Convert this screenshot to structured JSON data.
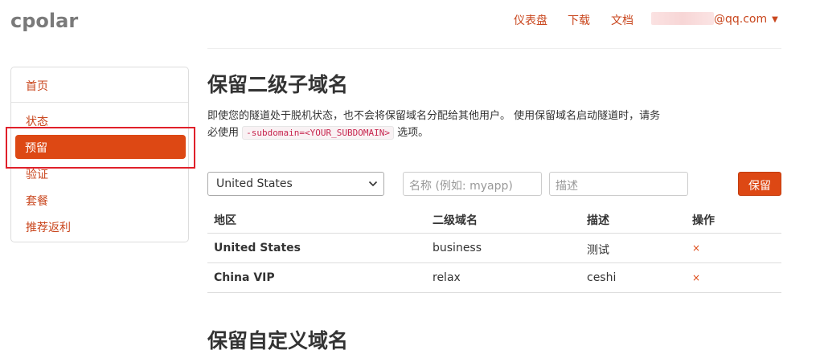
{
  "brand": {
    "logo": "cpolar"
  },
  "topnav": {
    "items": [
      "仪表盘",
      "下载",
      "文档"
    ],
    "user_email_suffix": "@qq.com"
  },
  "sidebar": {
    "items": [
      "首页",
      "状态",
      "预留",
      "验证",
      "套餐",
      "推荐返利"
    ],
    "active_index": 2
  },
  "main": {
    "title": "保留二级子域名",
    "description_part1": "即使您的隧道处于脱机状态，也不会将保留域名分配给其他用户。 使用保留域名启动隧道时，请务必使用",
    "code": "-subdomain=<YOUR_SUBDOMAIN>",
    "description_part2": "选项。",
    "form": {
      "region_value": "United States",
      "name_placeholder": "名称 (例如: myapp)",
      "desc_placeholder": "描述",
      "submit_label": "保留"
    },
    "table": {
      "headers": [
        "地区",
        "二级域名",
        "描述",
        "操作"
      ],
      "rows": [
        {
          "region": "United States",
          "subdomain": "business",
          "description": "测试",
          "action": "×"
        },
        {
          "region": "China VIP",
          "subdomain": "relax",
          "description": "ceshi",
          "action": "×"
        }
      ]
    },
    "section2_title": "保留自定义域名"
  },
  "colors": {
    "accent": "#dd4814",
    "link": "#c9461d",
    "highlight_box": "#e0202a"
  }
}
